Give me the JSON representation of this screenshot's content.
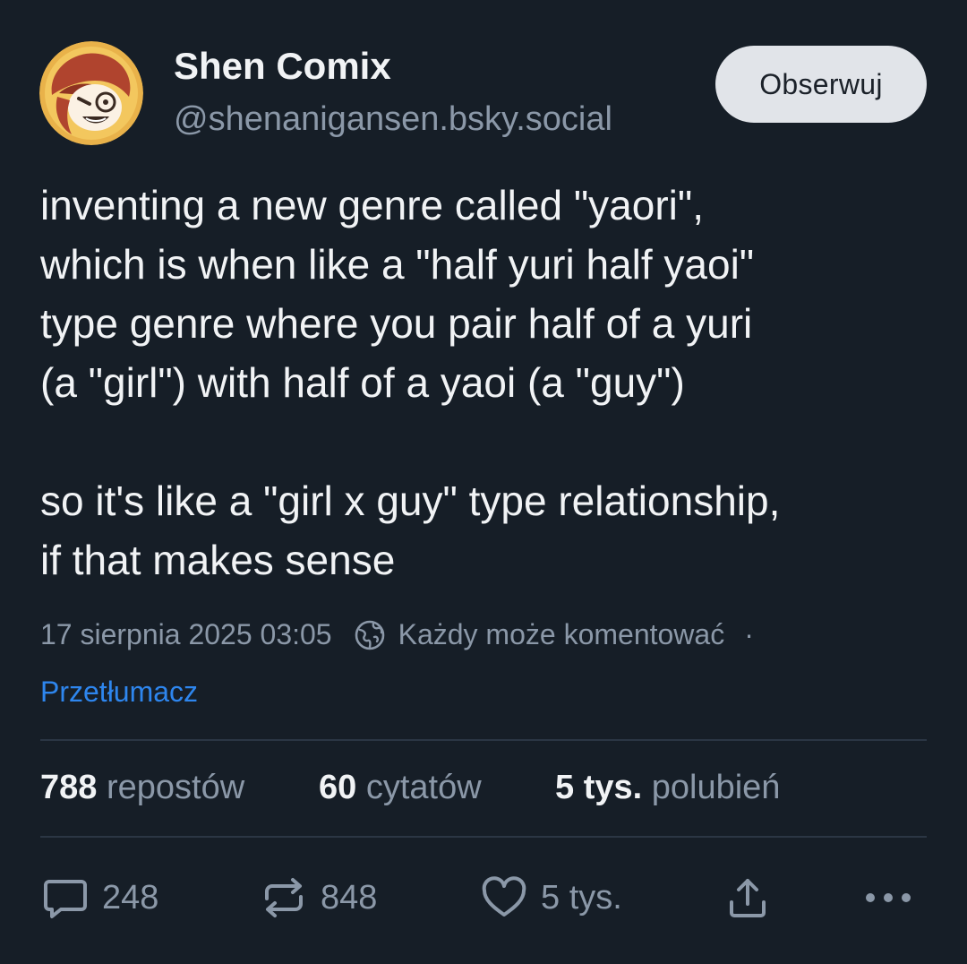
{
  "author": {
    "display_name": "Shen Comix",
    "handle": "@shenanigansen.bsky.social",
    "avatar_icon": "cartoon-avatar"
  },
  "follow_button": {
    "label": "Obserwuj"
  },
  "post": {
    "lines": [
      "inventing a new genre called \"yaori\",",
      "which is when like a \"half yuri half yaoi\"",
      "type genre where you pair half of a yuri",
      "(a \"girl\") with half of a yaoi (a \"guy\")",
      "so it's like a \"girl x guy\" type relationship,",
      "if that makes sense"
    ]
  },
  "meta": {
    "timestamp": "17 sierpnia 2025 03:05",
    "reply_setting": "Każdy może komentować",
    "separator": "·",
    "translate_label": "Przetłumacz"
  },
  "stats": {
    "reposts_count": "788",
    "reposts_label": "repostów",
    "quotes_count": "60",
    "quotes_label": "cytatów",
    "likes_count": "5 tys.",
    "likes_label": "polubień"
  },
  "actions": {
    "reply_count": "248",
    "repost_count": "848",
    "like_count": "5 tys."
  },
  "colors": {
    "background": "#161e27",
    "text_primary": "#f1f3f5",
    "text_secondary": "#8b98a8",
    "link": "#2e86ee",
    "button_bg": "#e1e4e9"
  }
}
